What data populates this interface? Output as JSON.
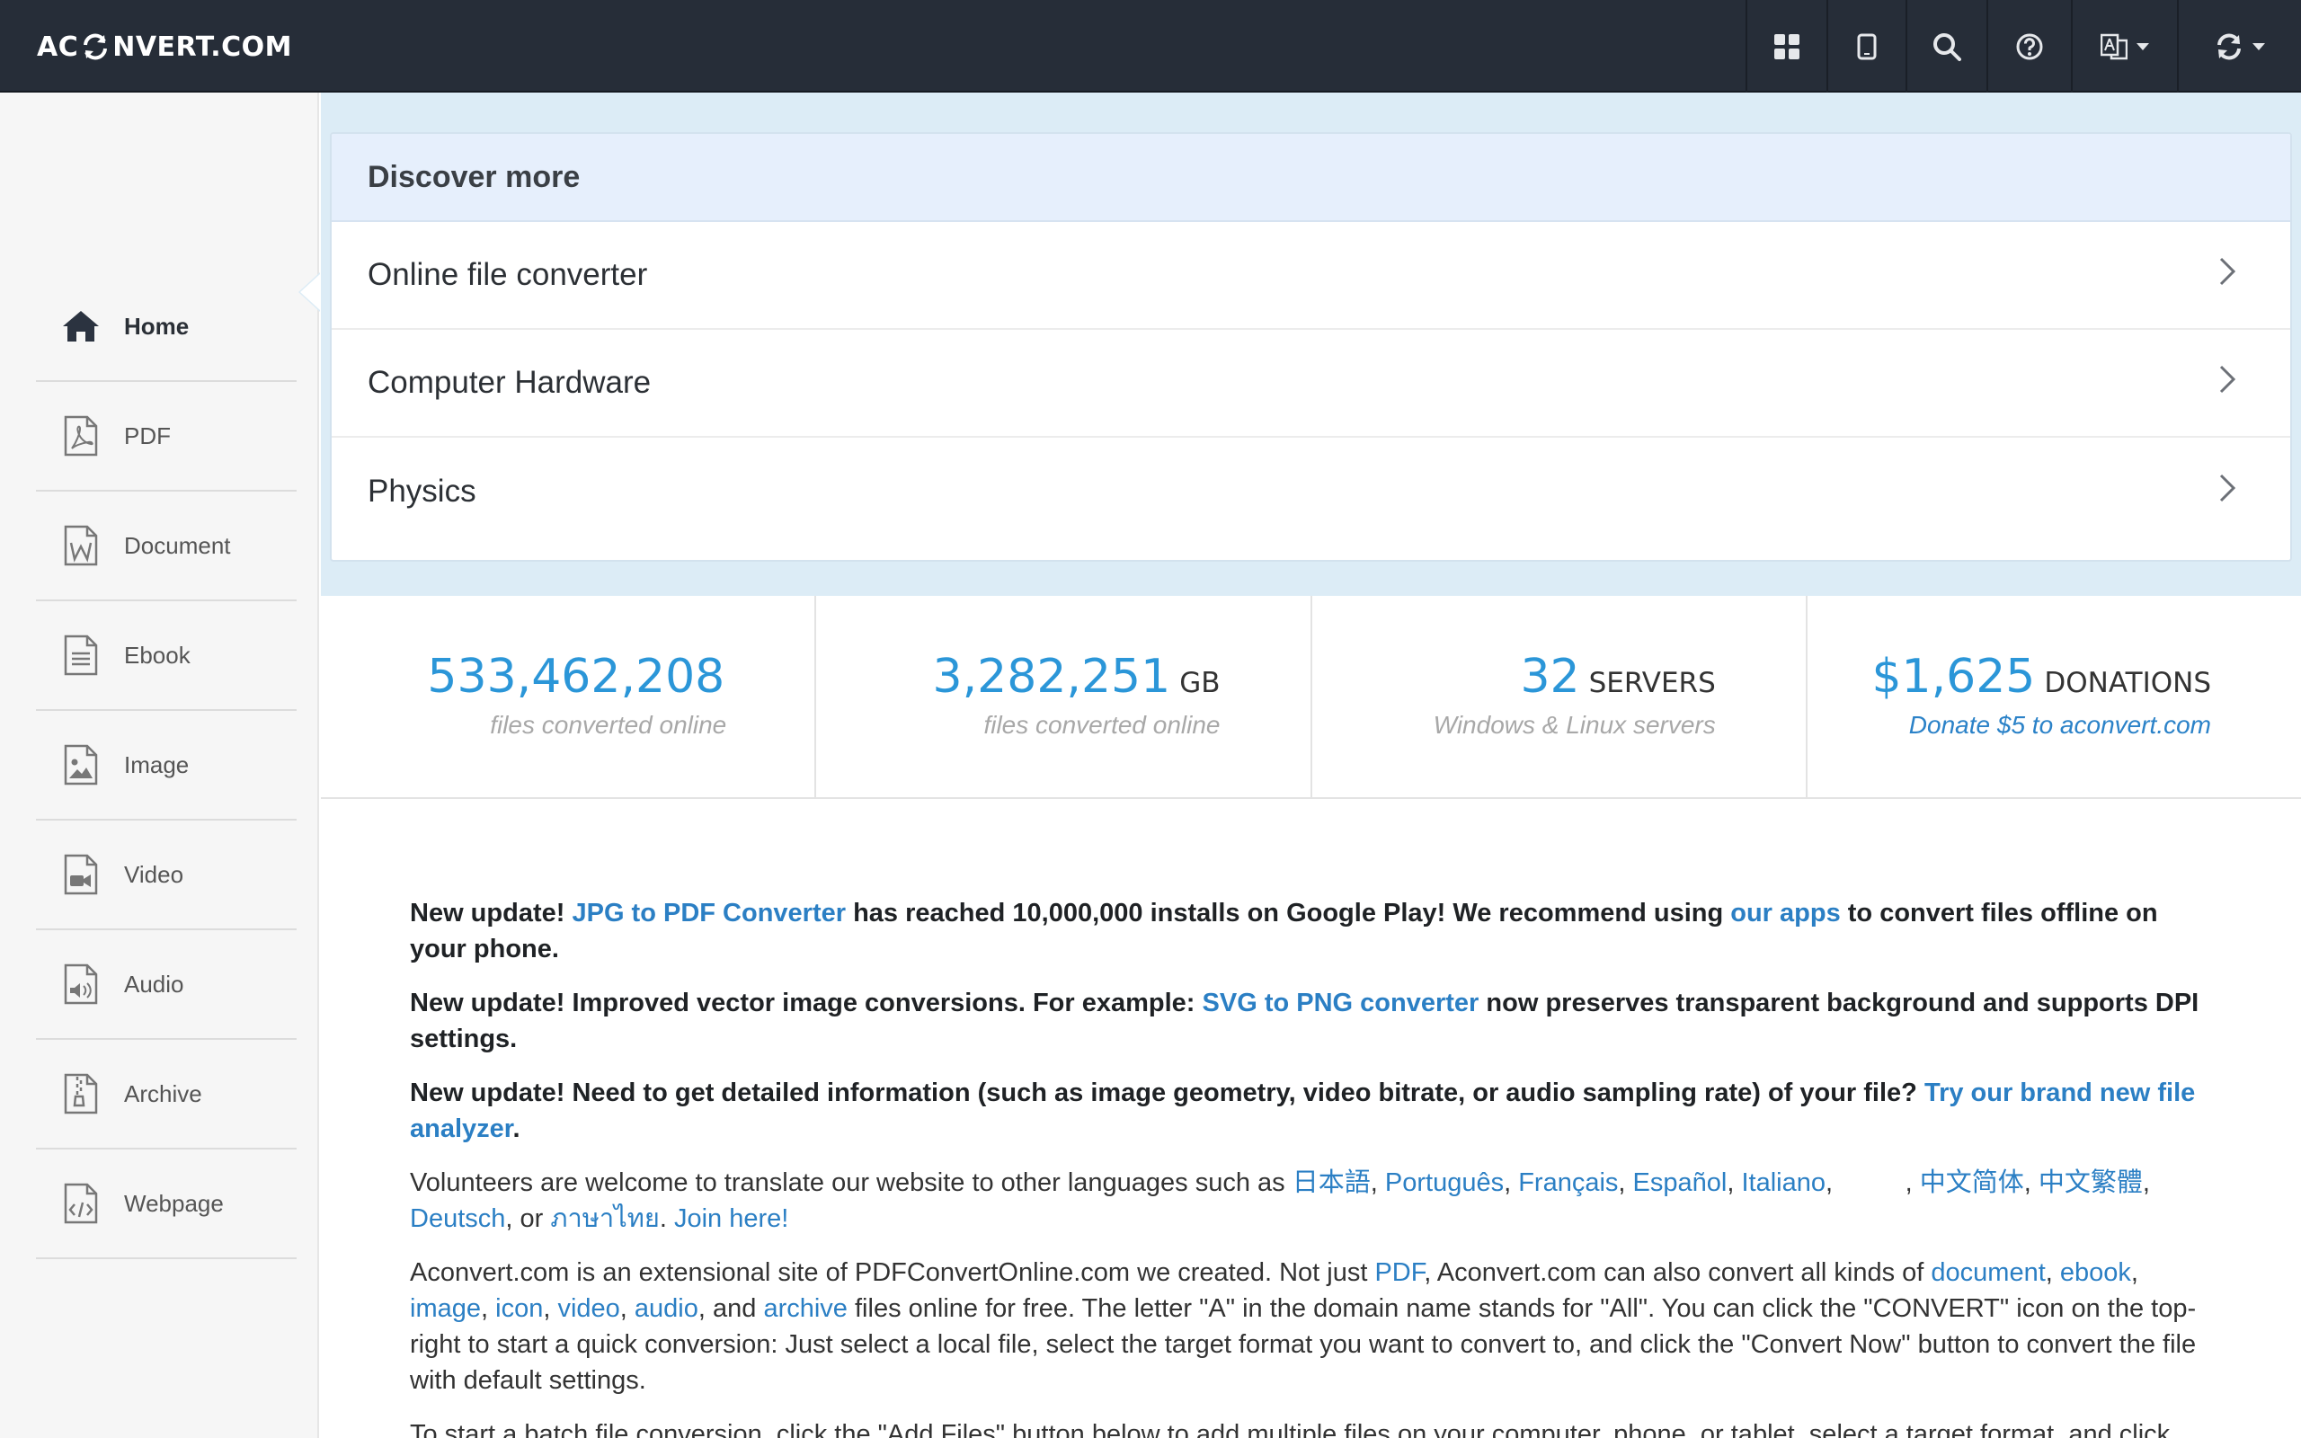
{
  "header": {
    "logo_left": "AC",
    "logo_right": "NVERT.COM",
    "icons": [
      "grid-icon",
      "tablet-icon",
      "search-icon",
      "help-icon",
      "language-icon",
      "convert-icon"
    ]
  },
  "sidebar": {
    "items": [
      {
        "label": "Home",
        "icon": "home-icon",
        "active": true
      },
      {
        "label": "PDF",
        "icon": "pdf-file-icon"
      },
      {
        "label": "Document",
        "icon": "word-file-icon"
      },
      {
        "label": "Ebook",
        "icon": "ebook-file-icon"
      },
      {
        "label": "Image",
        "icon": "image-file-icon"
      },
      {
        "label": "Video",
        "icon": "video-file-icon"
      },
      {
        "label": "Audio",
        "icon": "audio-file-icon"
      },
      {
        "label": "Archive",
        "icon": "archive-file-icon"
      },
      {
        "label": "Webpage",
        "icon": "webpage-file-icon"
      }
    ]
  },
  "discover": {
    "title": "Discover more",
    "items": [
      "Online file converter",
      "Computer Hardware",
      "Physics"
    ]
  },
  "stats": [
    {
      "value": "533,462,208",
      "unit": "",
      "sub": "files converted online"
    },
    {
      "value": "3,282,251",
      "unit": "GB",
      "sub": "files converted online"
    },
    {
      "value": "32",
      "unit": "SERVERS",
      "sub": "Windows & Linux servers"
    },
    {
      "value": "$1,625",
      "unit": "DONATIONS",
      "sub": "Donate $5 to aconvert.com"
    }
  ],
  "content": {
    "p1": {
      "a": "New update! ",
      "link1": "JPG to PDF Converter",
      "b": " has reached 10,000,000 installs on Google Play! We recommend using ",
      "link2": "our apps",
      "c": " to convert files offline on your phone."
    },
    "p2": {
      "a": "New update! Improved vector image conversions. For example: ",
      "link1": "SVG to PNG converter",
      "b": " now preserves transparent background and supports DPI settings."
    },
    "p3": {
      "a": "New update! Need to get detailed information (such as image geometry, video bitrate, or audio sampling rate) of your file? ",
      "link1": "Try our brand new file analyzer",
      "b": "."
    },
    "p4": {
      "a": "Volunteers are welcome to translate our website to other languages such as ",
      "langs": [
        "日本語",
        "Português",
        "Français",
        "Español",
        "Italiano"
      ],
      "gap": "          ",
      "langs2": [
        "中文简体",
        "中文繁體"
      ],
      "lang_de": "Deutsch",
      "or": ", or ",
      "lang_last": "ภาษาไทย",
      "join": "Join here!"
    },
    "p5": {
      "a": "Aconvert.com is an extensional site of PDFConvertOnline.com we created. Not just ",
      "pdf": "PDF",
      "b": ", Aconvert.com can also convert all kinds of ",
      "l_document": "document",
      "l_ebook": "ebook",
      "l_image": "image",
      "l_icon": "icon",
      "l_video": "video",
      "l_audio": "audio",
      "and": ", and ",
      "l_archive": "archive",
      "c": " files online for free. The letter \"A\" in the domain name stands for \"All\". You can click the \"CONVERT\" icon on the top-right to start a quick conversion: Just select a local file, select the target format you want to convert to, and click the \"Convert Now\" button to convert the file with default settings."
    },
    "p6": "To start a batch file conversion, click the \"Add Files\" button below to add multiple files on your computer, phone, or tablet, select a target format, and click"
  }
}
